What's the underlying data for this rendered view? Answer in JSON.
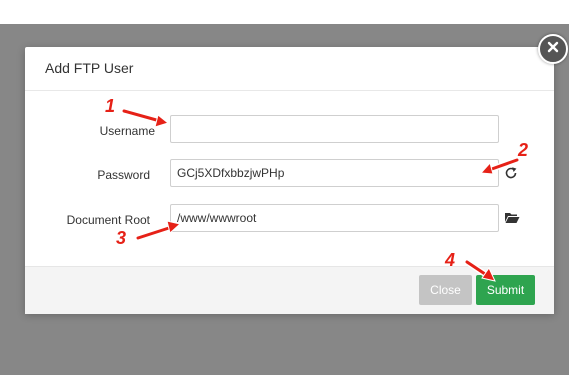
{
  "dialog": {
    "title": "Add FTP User",
    "close_icon": "close-icon"
  },
  "form": {
    "username": {
      "label": "Username",
      "value": "",
      "placeholder": ""
    },
    "password": {
      "label": "Password",
      "value": "GCj5XDfxbbzjwPHp",
      "refresh_icon": "refresh-icon"
    },
    "document_root": {
      "label": "Document Root",
      "value": "/www/wwwroot",
      "folder_icon": "folder-open-icon"
    }
  },
  "footer": {
    "close_label": "Close",
    "submit_label": "Submit"
  },
  "annotations": {
    "markers": [
      "1",
      "2",
      "3",
      "4"
    ],
    "color": "#e62117"
  },
  "colors": {
    "submit": "#2ea44f",
    "close_button": "#c4c4c4",
    "overlay": "#878787"
  }
}
